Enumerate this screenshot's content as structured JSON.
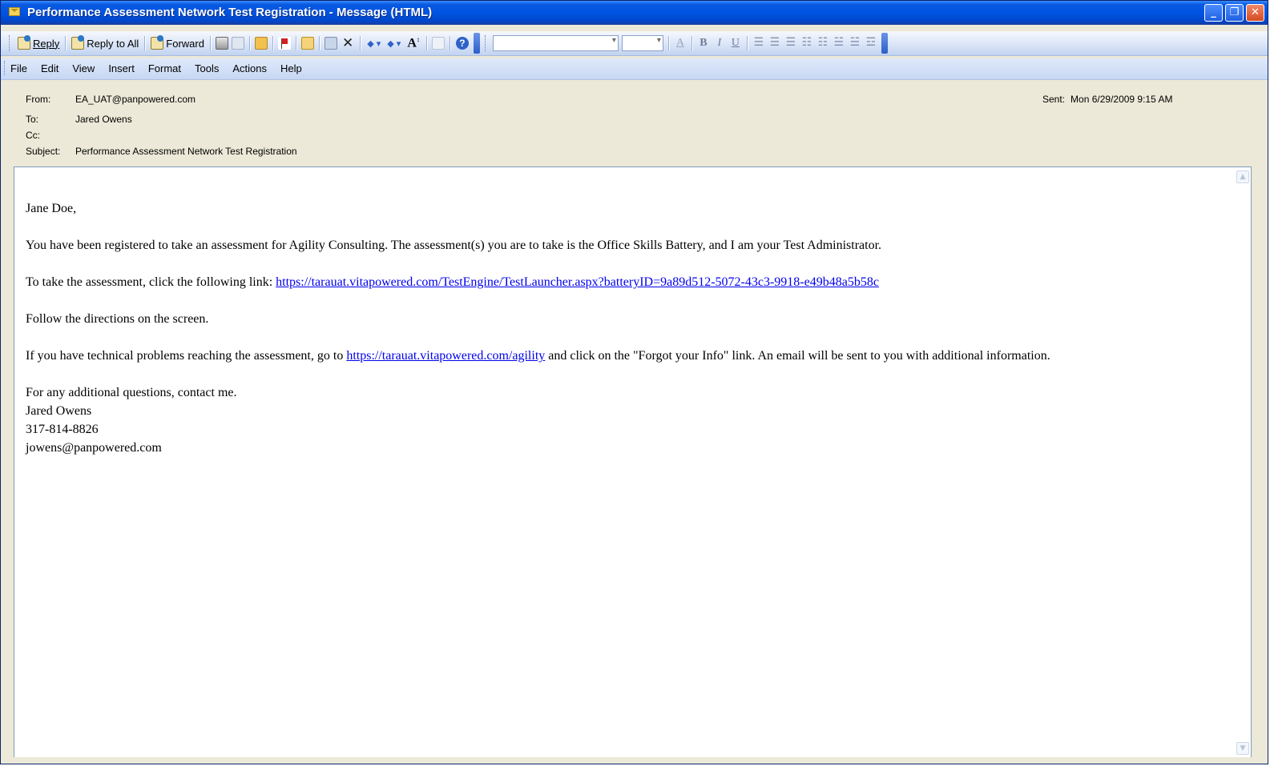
{
  "window": {
    "title": "Performance Assessment Network Test Registration - Message (HTML)",
    "controls": {
      "minimize": "_",
      "restore": "❐",
      "close": "✕"
    }
  },
  "toolbar": {
    "reply_label": "Reply",
    "reply_all_label": "Reply to All",
    "forward_label": "Forward",
    "icons": [
      "reply-icon",
      "reply-all-icon",
      "forward-icon",
      "print-icon",
      "copy-icon",
      "flag-icon",
      "move-icon",
      "delete-icon",
      "previous-icon",
      "next-icon",
      "font-size-icon",
      "help-icon"
    ],
    "delete_glyph": "✕",
    "help_glyph": "?",
    "format": {
      "font_color": "A",
      "bold": "B",
      "italic": "I",
      "underline": "U"
    }
  },
  "menu": {
    "items": [
      "File",
      "Edit",
      "View",
      "Insert",
      "Format",
      "Tools",
      "Actions",
      "Help"
    ]
  },
  "header": {
    "from_label": "From:",
    "from_value": "EA_UAT@panpowered.com",
    "to_label": "To:",
    "to_value": "Jared Owens",
    "cc_label": "Cc:",
    "cc_value": "",
    "subject_label": "Subject:",
    "subject_value": "Performance Assessment Network Test Registration",
    "sent_label": "Sent:",
    "sent_value": "Mon 6/29/2009 9:15 AM"
  },
  "message": {
    "greeting": "Jane Doe,",
    "para1": "You have been registered to take an assessment for Agility Consulting. The assessment(s) you are to take is the Office Skills Battery, and I am your Test Administrator.",
    "para2_prefix": "To take the assessment, click the following link: ",
    "para2_link": "https://tarauat.vitapowered.com/TestEngine/TestLauncher.aspx?batteryID=9a89d512-5072-43c3-9918-e49b48a5b58c",
    "para3": "Follow the directions on the screen.",
    "para4_prefix": "If you have technical problems reaching the assessment, go to ",
    "para4_link": "https://tarauat.vitapowered.com/agility",
    "para4_suffix": " and click on the \"Forgot your Info\" link. An email will be sent to you with additional information.",
    "closing": "For any additional questions, contact me.",
    "sig_name": "Jared Owens",
    "sig_phone": "317-814-8826",
    "sig_email": "jowens@panpowered.com"
  }
}
